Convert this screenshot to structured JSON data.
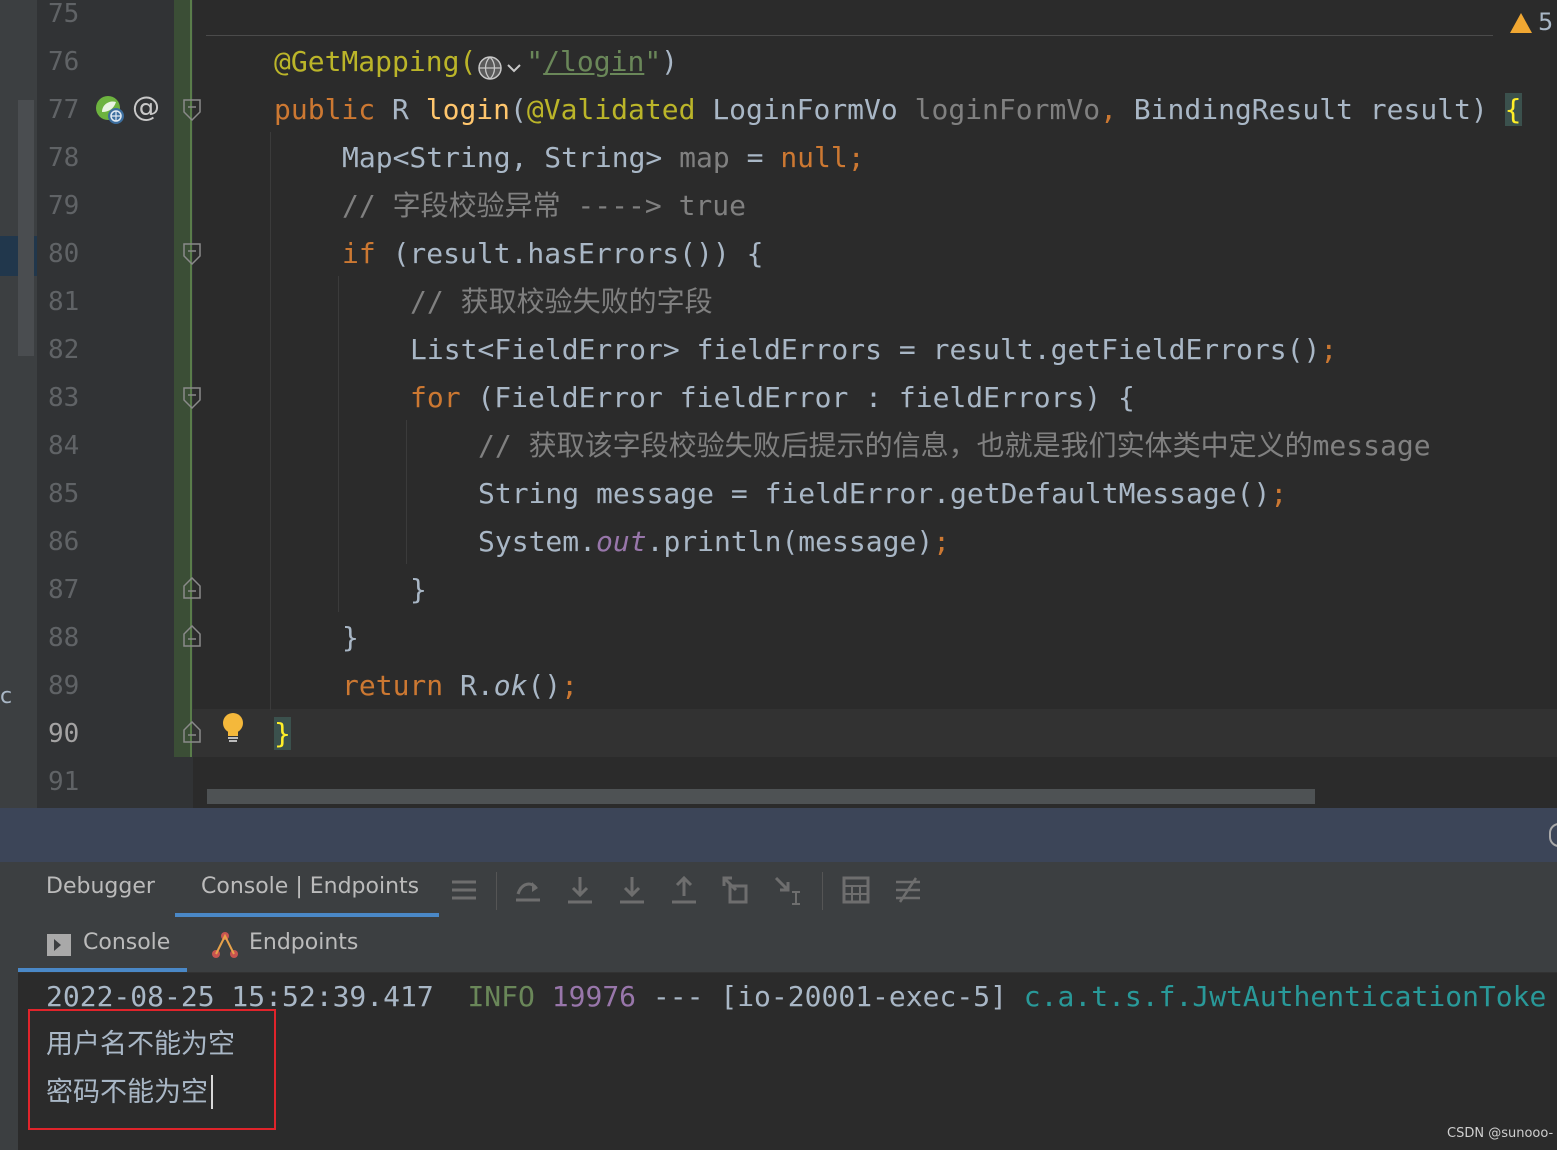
{
  "editor": {
    "line_numbers": [
      "75",
      "76",
      "77",
      "78",
      "79",
      "80",
      "81",
      "82",
      "83",
      "84",
      "85",
      "86",
      "87",
      "88",
      "89",
      "90",
      "91"
    ],
    "current_line": "90",
    "warning_count": "5",
    "left_strip_char": "c",
    "code": {
      "l76": {
        "annotation": "@GetMapping(",
        "quote_open": "\"",
        "url": "/login",
        "quote_close": "\"",
        "close": ")"
      },
      "l77": {
        "kw": "public",
        "type": " R ",
        "method": "login",
        "open": "(",
        "annotation": "@Validated",
        "ptype": " LoginFormVo ",
        "pname": "loginFormVo",
        "comma": ",",
        "rest": " BindingResult result) ",
        "brace": "{"
      },
      "l78": {
        "text": "Map<String, String> ",
        "var": "map",
        "eq": " = ",
        "kw": "null",
        "semi": ";"
      },
      "l79": {
        "comment": "// 字段校验异常 ----> true"
      },
      "l80": {
        "kw": "if",
        "text": " (result.hasErrors()) {"
      },
      "l81": {
        "comment": "// 获取校验失败的字段"
      },
      "l82": {
        "text": "List<FieldError> fieldErrors = result.getFieldErrors()",
        "semi": ";"
      },
      "l83": {
        "kw": "for",
        "text": " (FieldError fieldError : fieldErrors) {"
      },
      "l84": {
        "comment": "// 获取该字段校验失败后提示的信息，也就是我们实体类中定义的message"
      },
      "l85": {
        "text": "String message = fieldError.getDefaultMessage()",
        "semi": ";"
      },
      "l86": {
        "pre": "System.",
        "field": "out",
        "post": ".println(message)",
        "semi": ";"
      },
      "l87": {
        "text": "}"
      },
      "l88": {
        "text": "}"
      },
      "l89": {
        "kw": "return",
        "pre": " R.",
        "method": "ok",
        "post": "()",
        "semi": ";"
      },
      "l90": {
        "brace": "}"
      }
    }
  },
  "toolwindow": {
    "tabs": [
      "Debugger",
      "Console | Endpoints"
    ],
    "active_tab": "Console | Endpoints",
    "toolbar_icons": [
      "menu-icon",
      "show-execution-point-icon",
      "step-over-icon",
      "step-into-icon",
      "step-out-icon",
      "drop-frame-icon",
      "run-to-cursor-icon",
      "evaluate-expression-icon",
      "trace-icon"
    ],
    "subtabs": [
      {
        "label": "Console",
        "icon": "console-icon"
      },
      {
        "label": "Endpoints",
        "icon": "endpoints-icon"
      }
    ]
  },
  "console": {
    "log_line": {
      "timestamp": "2022-08-25 15:52:39.417",
      "level": "INFO",
      "pid": "19976",
      "sep": "---",
      "thread": "[io-20001-exec-5]",
      "logger": "c.a.t.s.f.JwtAuthenticationToke"
    },
    "output": [
      "用户名不能为空",
      "密码不能为空"
    ]
  },
  "watermark": "CSDN @sunooo-",
  "colors": {
    "keyword": "#cc7832",
    "annotation": "#bbb529",
    "method": "#ffc66d",
    "string": "#6a8759",
    "comment": "#808080",
    "highlight_box": "#e0242b",
    "tab_underline": "#4a88c7"
  }
}
